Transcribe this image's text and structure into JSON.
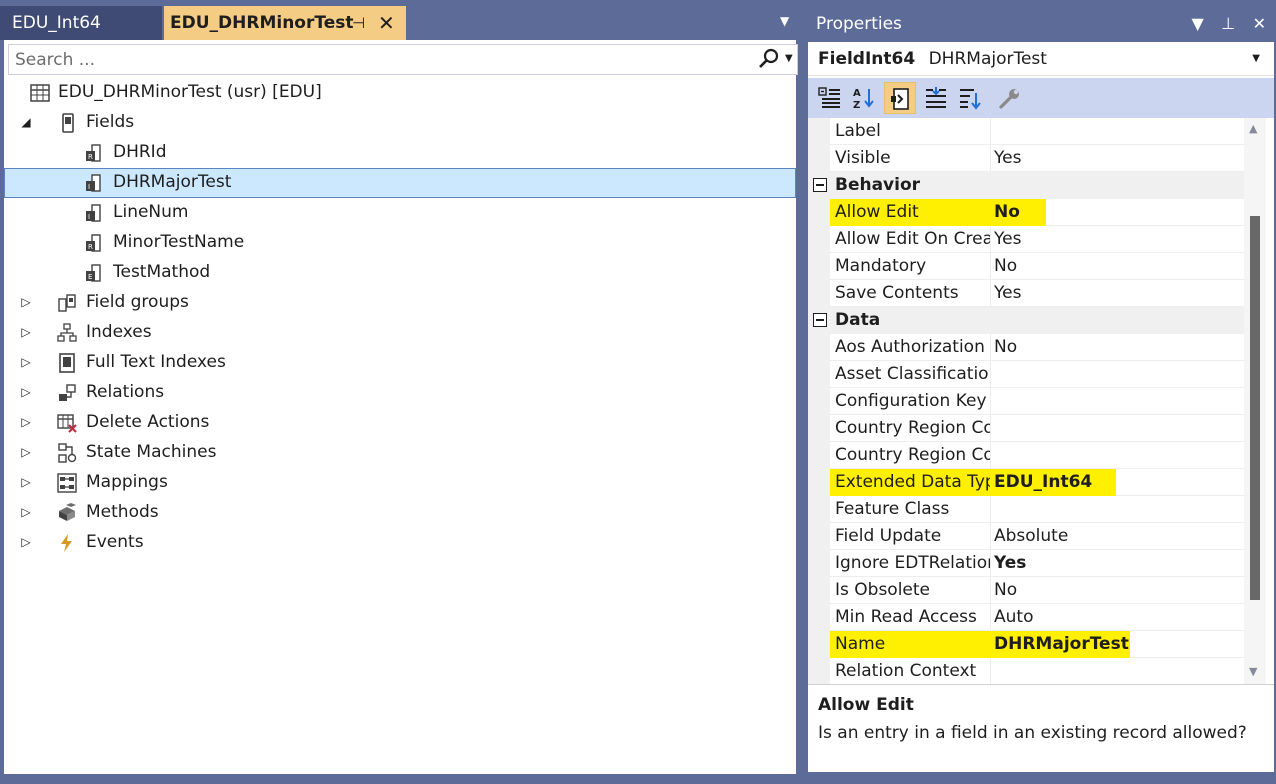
{
  "tabs": [
    {
      "label": "EDU_Int64",
      "active": false
    },
    {
      "label": "EDU_DHRMinorTest",
      "active": true
    }
  ],
  "search": {
    "placeholder": "Search ..."
  },
  "tree": {
    "root": "EDU_DHRMinorTest (usr) [EDU]",
    "fields_label": "Fields",
    "fields": [
      "DHRId",
      "DHRMajorTest",
      "LineNum",
      "MinorTestName",
      "TestMathod"
    ],
    "selected_field": "DHRMajorTest",
    "nodes": [
      "Field groups",
      "Indexes",
      "Full Text Indexes",
      "Relations",
      "Delete Actions",
      "State Machines",
      "Mappings",
      "Methods",
      "Events"
    ]
  },
  "properties": {
    "title": "Properties",
    "object_type": "FieldInt64",
    "object_name": "DHRMajorTest",
    "top_rows": [
      {
        "name": "Label",
        "value": ""
      },
      {
        "name": "Visible",
        "value": "Yes"
      }
    ],
    "behavior": {
      "title": "Behavior",
      "rows": [
        {
          "name": "Allow Edit",
          "value": "No"
        },
        {
          "name": "Allow Edit On Create",
          "value": "Yes"
        },
        {
          "name": "Mandatory",
          "value": "No"
        },
        {
          "name": "Save Contents",
          "value": "Yes"
        }
      ]
    },
    "data": {
      "title": "Data",
      "rows": [
        {
          "name": "Aos Authorization",
          "value": "No"
        },
        {
          "name": "Asset Classification",
          "value": ""
        },
        {
          "name": "Configuration Key",
          "value": ""
        },
        {
          "name": "Country Region Codes",
          "value": ""
        },
        {
          "name": "Country Region Context",
          "value": ""
        },
        {
          "name": "Extended Data Type",
          "value": "EDU_Int64"
        },
        {
          "name": "Feature Class",
          "value": ""
        },
        {
          "name": "Field Update",
          "value": "Absolute"
        },
        {
          "name": "Ignore EDTRelation",
          "value": "Yes"
        },
        {
          "name": "Is Obsolete",
          "value": "No"
        },
        {
          "name": "Min Read Access",
          "value": "Auto"
        },
        {
          "name": "Name",
          "value": "DHRMajorTest"
        },
        {
          "name": "Relation Context",
          "value": ""
        }
      ]
    },
    "description": {
      "title": "Allow Edit",
      "text": "Is an entry in a field in an existing record allowed?"
    }
  },
  "colors": {
    "accent_tab": "#f5cc84",
    "chrome": "#5d6b99",
    "highlight": "#ffef00",
    "selection": "#cce8ff"
  }
}
